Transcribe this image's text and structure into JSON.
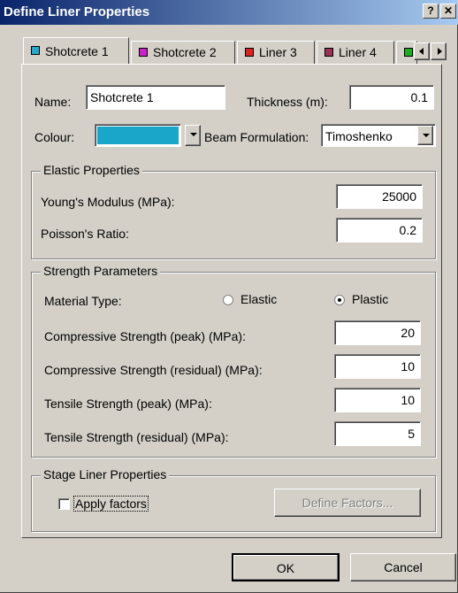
{
  "window": {
    "title": "Define Liner Properties",
    "help_label": "?",
    "close_label": "✕"
  },
  "tabs": [
    {
      "label": "Shotcrete 1",
      "color": "#2aa8cc"
    },
    {
      "label": "Shotcrete 2",
      "color": "#cc22cc"
    },
    {
      "label": "Liner 3",
      "color": "#dd2222"
    },
    {
      "label": "Liner 4",
      "color": "#993355"
    },
    {
      "label": "",
      "color": "#22aa22"
    }
  ],
  "form": {
    "name_label": "Name:",
    "name_value": "Shotcrete 1",
    "thickness_label": "Thickness (m):",
    "thickness_value": "0.1",
    "colour_label": "Colour:",
    "colour_value": "#1aa6c8",
    "beam_label": "Beam Formulation:",
    "beam_value": "Timoshenko"
  },
  "elastic": {
    "title": "Elastic Properties",
    "youngs_label": "Young's Modulus (MPa):",
    "youngs_value": "25000",
    "poisson_label": "Poisson's Ratio:",
    "poisson_value": "0.2"
  },
  "strength": {
    "title": "Strength Parameters",
    "material_label": "Material Type:",
    "elastic_option": "Elastic",
    "plastic_option": "Plastic",
    "selected": "Plastic",
    "comp_peak_label": "Compressive Strength (peak) (MPa):",
    "comp_peak_value": "20",
    "comp_res_label": "Compressive Strength (residual) (MPa):",
    "comp_res_value": "10",
    "tens_peak_label": "Tensile Strength (peak) (MPa):",
    "tens_peak_value": "10",
    "tens_res_label": "Tensile Strength (residual) (MPa):",
    "tens_res_value": "5"
  },
  "stage": {
    "title": "Stage Liner Properties",
    "apply_label": "Apply factors",
    "apply_checked": false,
    "define_button": "Define Factors..."
  },
  "buttons": {
    "ok": "OK",
    "cancel": "Cancel"
  }
}
